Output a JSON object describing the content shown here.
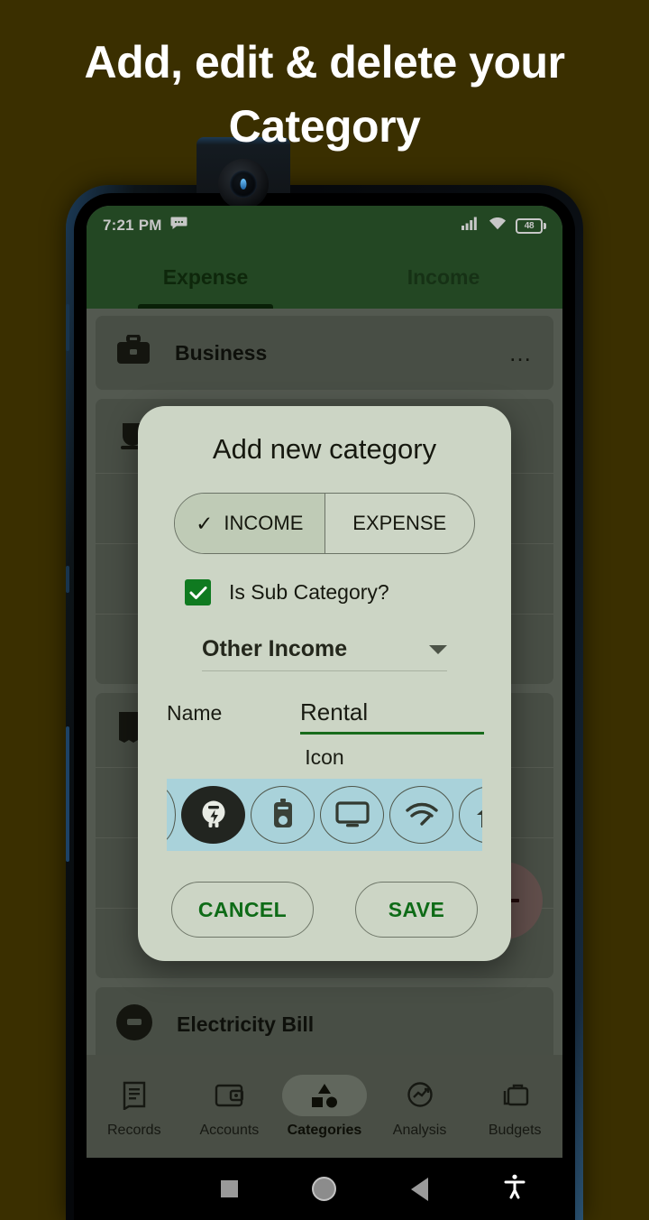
{
  "promo": {
    "headline_line1": "Add, edit & delete your",
    "headline_line2": "Category",
    "background_color": "#3a2f00",
    "text_color": "#ffffff"
  },
  "status_bar": {
    "time": "7:21 PM",
    "message_icon": "message-icon",
    "signal_icon": "cellular-signal-icon",
    "wifi_icon": "wifi-icon",
    "battery_level": "48",
    "background_color": "#2d5b2e"
  },
  "app": {
    "accent_green": "#2d5b2e",
    "tabs": [
      {
        "label": "Expense",
        "active": true
      },
      {
        "label": "Income",
        "active": false
      }
    ],
    "categories": [
      {
        "name": "Business",
        "icon": "briefcase-icon",
        "menu": "…"
      },
      {
        "name": "",
        "icon": "cup-icon",
        "menu": ""
      },
      {
        "name": "",
        "icon": "receipt-icon",
        "menu": ""
      },
      {
        "name": "Electricity Bill",
        "icon": "bulb-icon",
        "menu": ""
      }
    ],
    "fab": {
      "label": "+",
      "name": "add-category-fab",
      "color": "#7d6561"
    },
    "bottom_nav": [
      {
        "label": "Records",
        "icon": "records-icon",
        "active": false
      },
      {
        "label": "Accounts",
        "icon": "wallet-icon",
        "active": false
      },
      {
        "label": "Categories",
        "icon": "shapes-icon",
        "active": true
      },
      {
        "label": "Analysis",
        "icon": "analysis-icon",
        "active": false
      },
      {
        "label": "Budgets",
        "icon": "briefcase-icon",
        "active": false
      }
    ]
  },
  "dialog": {
    "title": "Add new category",
    "background_color": "#ccd5c5",
    "segmented": {
      "options": [
        {
          "label": "INCOME",
          "selected": true,
          "check": "✓"
        },
        {
          "label": "EXPENSE",
          "selected": false,
          "check": ""
        }
      ]
    },
    "sub_category": {
      "label": "Is Sub Category?",
      "checked": true,
      "check_color": "#0f7a20"
    },
    "parent_dropdown": {
      "value": "Other Income",
      "caret": "chevron-down-icon"
    },
    "name_field": {
      "label": "Name",
      "value": "Rental",
      "placeholder": "Name",
      "underline_color": "#186b1c"
    },
    "icon_picker": {
      "label": "Icon",
      "strip_color": "#a9d2da",
      "icons": [
        {
          "name": "partial-left-icon",
          "selected": false
        },
        {
          "name": "electric-bulb-icon",
          "selected": true
        },
        {
          "name": "gas-cylinder-icon",
          "selected": false
        },
        {
          "name": "television-icon",
          "selected": false
        },
        {
          "name": "wifi-speed-icon",
          "selected": false
        },
        {
          "name": "house-icon",
          "selected": false
        }
      ]
    },
    "actions": {
      "cancel_label": "CANCEL",
      "save_label": "SAVE",
      "text_color": "#0e6b17"
    }
  },
  "android_nav": {
    "recents": "square-recents-icon",
    "home": "circle-home-icon",
    "back": "triangle-back-icon",
    "accessibility": "accessibility-icon"
  }
}
